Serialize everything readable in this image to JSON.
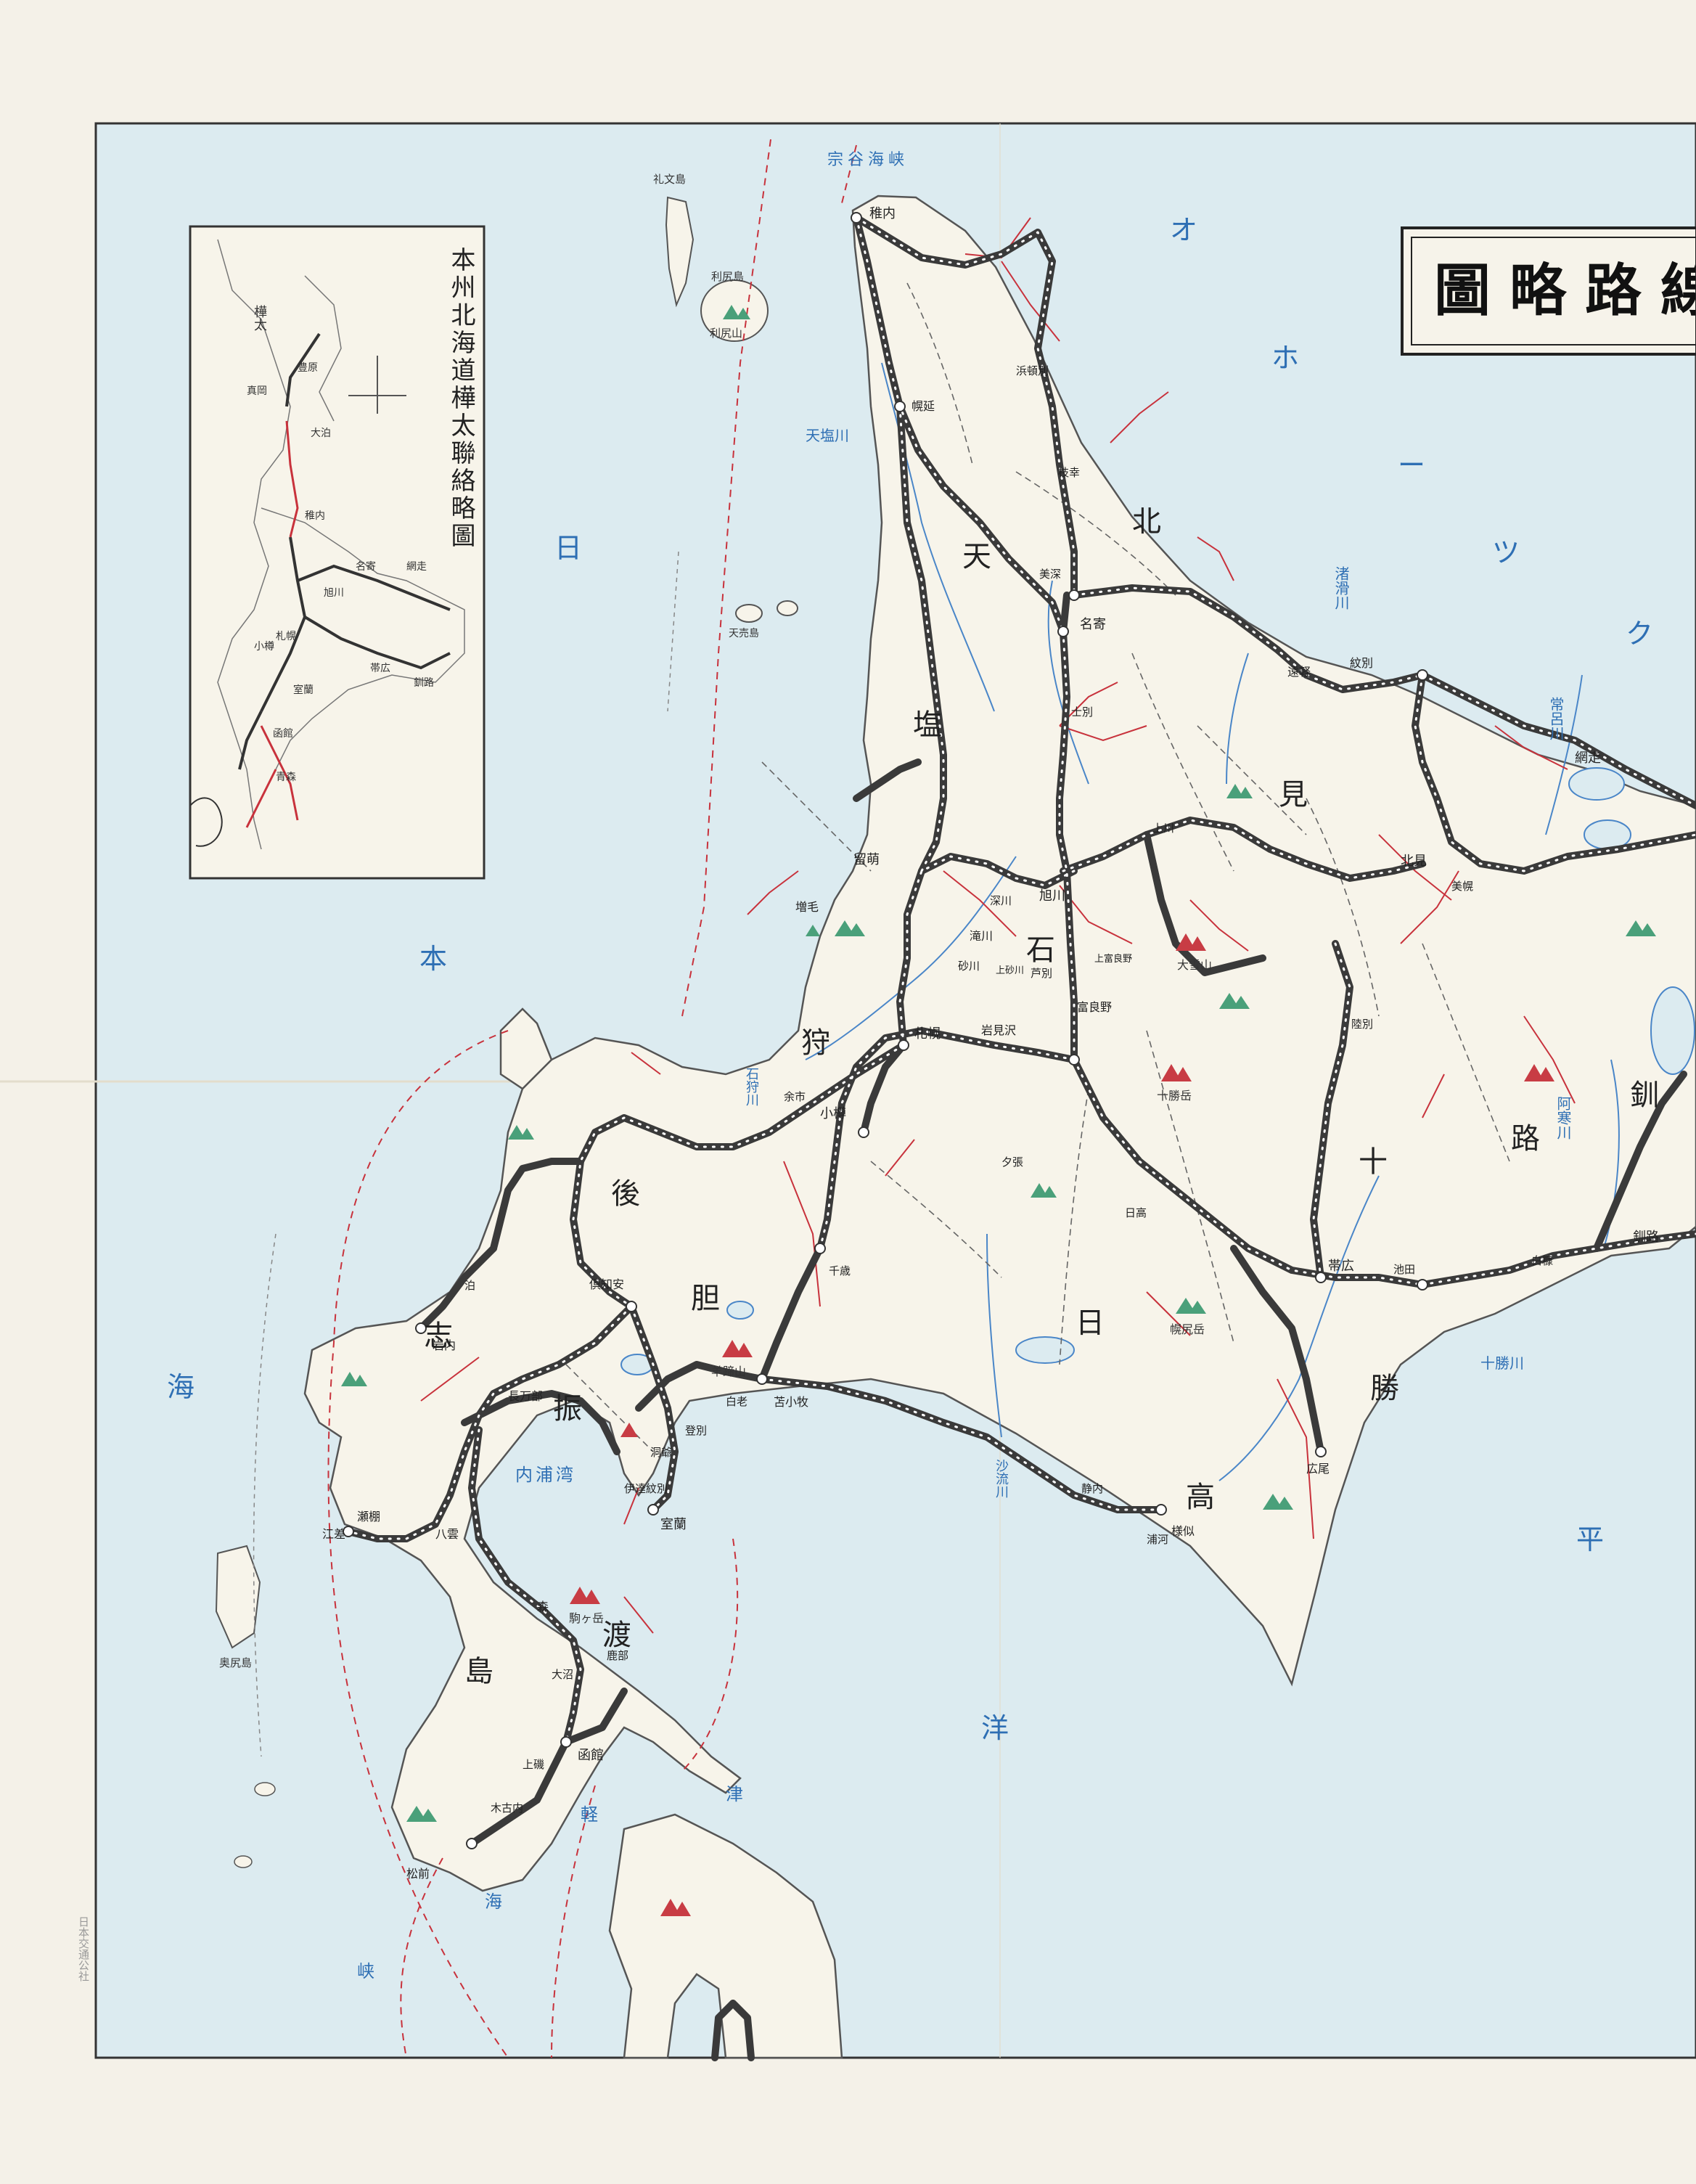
{
  "map": {
    "title": "線路略圖",
    "inset_title": "本州北海道樺太聯絡略圖",
    "printer_note": "日本交通公社",
    "colors": {
      "sea": "#dcebf0",
      "land": "#f7f4ea",
      "rail": "#3a3a3a",
      "bus": "#c8323c",
      "river": "#4a86c8",
      "mountain_green": "#4aa07a",
      "mountain_red": "#c83c44",
      "text_blue": "#2e6fb4"
    },
    "sea_labels": [
      {
        "id": "okhotsk-o",
        "text": "オ"
      },
      {
        "id": "okhotsk-ho",
        "text": "ホ"
      },
      {
        "id": "okhotsk-dash",
        "text": "ー"
      },
      {
        "id": "okhotsk-tsu",
        "text": "ツ"
      },
      {
        "id": "okhotsk-ku",
        "text": "ク"
      },
      {
        "id": "japan-sea-1",
        "text": "日"
      },
      {
        "id": "japan-sea-2",
        "text": "本"
      },
      {
        "id": "japan-sea-3",
        "text": "海"
      },
      {
        "id": "pacific-1",
        "text": "平"
      },
      {
        "id": "pacific-2",
        "text": "洋"
      },
      {
        "id": "tsugaru-1",
        "text": "津"
      },
      {
        "id": "tsugaru-2",
        "text": "軽"
      },
      {
        "id": "tsugaru-3",
        "text": "海"
      },
      {
        "id": "tsugaru-4",
        "text": "峡"
      },
      {
        "id": "soya-strait",
        "text": "宗谷海峡"
      },
      {
        "id": "uchiura-bay",
        "text": "内浦湾"
      }
    ],
    "region_labels": [
      {
        "id": "kitami-1",
        "text": "北"
      },
      {
        "id": "kitami-2",
        "text": "見"
      },
      {
        "id": "teshio-1",
        "text": "天"
      },
      {
        "id": "teshio-2",
        "text": "塩"
      },
      {
        "id": "ishikari-1",
        "text": "石"
      },
      {
        "id": "ishikari-2",
        "text": "狩"
      },
      {
        "id": "shiribeshi-1",
        "text": "後"
      },
      {
        "id": "shiribeshi-2",
        "text": "志"
      },
      {
        "id": "iburi-1",
        "text": "胆"
      },
      {
        "id": "iburi-2",
        "text": "振"
      },
      {
        "id": "hidaka-1",
        "text": "日"
      },
      {
        "id": "hidaka-2",
        "text": "高"
      },
      {
        "id": "tokachi-1",
        "text": "十"
      },
      {
        "id": "tokachi-2",
        "text": "勝"
      },
      {
        "id": "kushiro-1",
        "text": "釧"
      },
      {
        "id": "kushiro-2",
        "text": "路"
      },
      {
        "id": "oshima-1",
        "text": "渡"
      },
      {
        "id": "oshima-2",
        "text": "島"
      }
    ],
    "river_labels": [
      {
        "id": "teshio-river",
        "text": "天塩川"
      },
      {
        "id": "tokachi-river",
        "text": "十勝川"
      },
      {
        "id": "ishikari-river",
        "text": "石狩川"
      },
      {
        "id": "saru-river",
        "text": "沙流川"
      },
      {
        "id": "tokoro-river",
        "text": "常呂川"
      },
      {
        "id": "shibetsu-river",
        "text": "渚滑川"
      },
      {
        "id": "akan-river",
        "text": "阿寒川"
      }
    ],
    "mountain_labels": [
      {
        "id": "rishiri-mt",
        "text": "利尻山"
      },
      {
        "id": "daisetsu-mt",
        "text": "大雪山"
      },
      {
        "id": "yotei-mt",
        "text": "羊蹄山"
      },
      {
        "id": "komagatake-mt",
        "text": "駒ヶ岳"
      },
      {
        "id": "tokachi-mt",
        "text": "十勝岳"
      },
      {
        "id": "poroshiri-mt",
        "text": "幌尻岳"
      }
    ],
    "island_labels": [
      {
        "id": "rishiri-island",
        "text": "利尻島"
      },
      {
        "id": "rebun-island",
        "text": "礼文島"
      },
      {
        "id": "okushiri-island",
        "text": "奥尻島"
      },
      {
        "id": "teuri-island",
        "text": "天売島"
      }
    ],
    "station_labels": [
      {
        "id": "wakkanai",
        "text": "稚内"
      },
      {
        "id": "asahikawa",
        "text": "旭川"
      },
      {
        "id": "sapporo",
        "text": "札幌"
      },
      {
        "id": "otaru",
        "text": "小樽"
      },
      {
        "id": "hakodate",
        "text": "函館"
      },
      {
        "id": "muroran",
        "text": "室蘭"
      },
      {
        "id": "obihiro",
        "text": "帯広"
      },
      {
        "id": "kushiro",
        "text": "釧路"
      },
      {
        "id": "abashiri",
        "text": "網走"
      },
      {
        "id": "kitami",
        "text": "北見"
      },
      {
        "id": "nayoro",
        "text": "名寄"
      },
      {
        "id": "rumoi",
        "text": "留萌"
      },
      {
        "id": "iwamizawa",
        "text": "岩見沢"
      },
      {
        "id": "tomakomai",
        "text": "苫小牧"
      },
      {
        "id": "oshamambe",
        "text": "長万部"
      },
      {
        "id": "kutchan",
        "text": "倶知安"
      },
      {
        "id": "engaru",
        "text": "遠軽"
      },
      {
        "id": "monbetsu",
        "text": "紋別"
      },
      {
        "id": "horonobe",
        "text": "幌延"
      },
      {
        "id": "esashi",
        "text": "江差"
      },
      {
        "id": "matsumae",
        "text": "松前"
      },
      {
        "id": "samani",
        "text": "様似"
      },
      {
        "id": "hiroo",
        "text": "広尾"
      },
      {
        "id": "furano",
        "text": "富良野"
      },
      {
        "id": "takikawa",
        "text": "滝川"
      },
      {
        "id": "mashike",
        "text": "増毛"
      },
      {
        "id": "iwanai",
        "text": "岩内"
      },
      {
        "id": "date",
        "text": "伊達紋別"
      },
      {
        "id": "mori",
        "text": "森"
      },
      {
        "id": "yakumo",
        "text": "八雲"
      },
      {
        "id": "setana",
        "text": "瀬棚"
      },
      {
        "id": "shikabe",
        "text": "鹿部"
      },
      {
        "id": "onuma",
        "text": "大沼"
      },
      {
        "id": "kikonai",
        "text": "木古内"
      },
      {
        "id": "shiranuka",
        "text": "白糠"
      },
      {
        "id": "ikeda",
        "text": "池田"
      },
      {
        "id": "rikubetsu",
        "text": "陸別"
      },
      {
        "id": "shiraoi",
        "text": "白老"
      },
      {
        "id": "noboribetsu",
        "text": "登別"
      },
      {
        "id": "chitose",
        "text": "千歳"
      },
      {
        "id": "yubari",
        "text": "夕張"
      },
      {
        "id": "bifuka",
        "text": "美深"
      },
      {
        "id": "shibetsu",
        "text": "士別"
      },
      {
        "id": "esashi-kitami",
        "text": "枝幸"
      },
      {
        "id": "hamatonbetsu",
        "text": "浜頓別"
      },
      {
        "id": "bihoro",
        "text": "美幌"
      },
      {
        "id": "kamikawa",
        "text": "上川"
      },
      {
        "id": "ashibetsu",
        "text": "芦別"
      },
      {
        "id": "kamisunagawa",
        "text": "上砂川"
      },
      {
        "id": "sunagawa",
        "text": "砂川"
      },
      {
        "id": "fukagawa",
        "text": "深川"
      },
      {
        "id": "kamifurano",
        "text": "上富良野"
      },
      {
        "id": "hidaka-st",
        "text": "日高"
      },
      {
        "id": "shizunai",
        "text": "静内"
      },
      {
        "id": "urakawa",
        "text": "浦河"
      },
      {
        "id": "tomari",
        "text": "泊"
      },
      {
        "id": "toya",
        "text": "洞爺"
      },
      {
        "id": "kamiiso",
        "text": "上磯"
      },
      {
        "id": "yoichi",
        "text": "余市"
      }
    ],
    "inset_labels": [
      {
        "id": "inset-karafuto",
        "text": "樺太"
      },
      {
        "id": "inset-toyohara",
        "text": "豊原"
      },
      {
        "id": "inset-otomari",
        "text": "大泊"
      },
      {
        "id": "inset-maoka",
        "text": "真岡"
      },
      {
        "id": "inset-wakkanai",
        "text": "稚内"
      },
      {
        "id": "inset-asahikawa",
        "text": "旭川"
      },
      {
        "id": "inset-sapporo",
        "text": "札幌"
      },
      {
        "id": "inset-hakodate",
        "text": "函館"
      },
      {
        "id": "inset-aomori",
        "text": "青森"
      },
      {
        "id": "inset-kushiro",
        "text": "釧路"
      },
      {
        "id": "inset-abashiri",
        "text": "網走"
      },
      {
        "id": "inset-obihiro",
        "text": "帯広"
      },
      {
        "id": "inset-muroran",
        "text": "室蘭"
      },
      {
        "id": "inset-otaru",
        "text": "小樽"
      },
      {
        "id": "inset-nayoro",
        "text": "名寄"
      }
    ]
  }
}
